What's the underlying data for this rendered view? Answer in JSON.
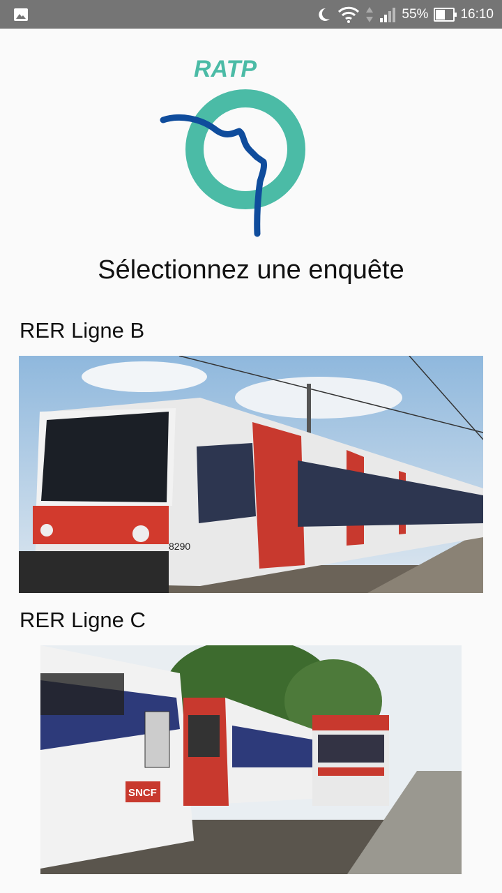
{
  "status_bar": {
    "battery_percent": "55%",
    "time": "16:10",
    "icons": [
      "image-icon",
      "moon-icon",
      "wifi-icon",
      "signal-icon",
      "battery-icon"
    ]
  },
  "logo": {
    "text": "RATP",
    "colors": {
      "teal": "#4bbba6",
      "blue": "#0f4c9c"
    }
  },
  "title": "Sélectionnez une enquête",
  "surveys": [
    {
      "label": "RER Ligne B"
    },
    {
      "label": "RER Ligne C"
    }
  ],
  "colors": {
    "status_bar": "#757575",
    "background": "#fafafa"
  }
}
